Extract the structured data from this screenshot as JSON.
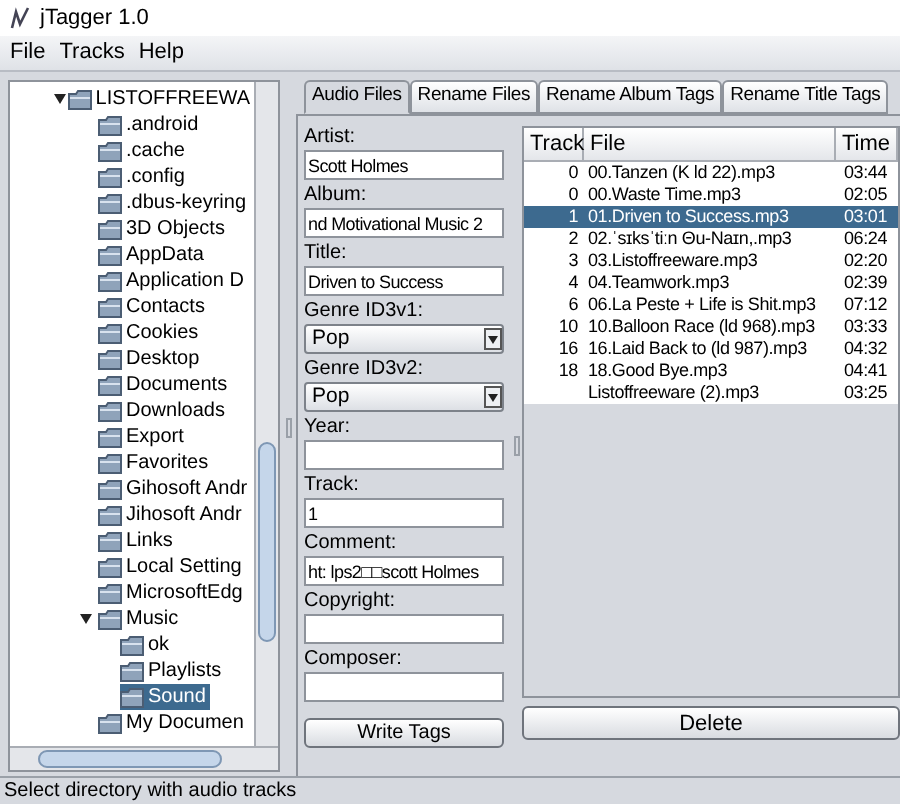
{
  "window": {
    "title": "jTagger 1.0"
  },
  "menu": [
    "File",
    "Tracks",
    "Help"
  ],
  "tree": [
    {
      "label": "LISTOFFREEWA",
      "expanded": true,
      "selected": false,
      "children": [
        {
          "label": ".android",
          "selected": false
        },
        {
          "label": ".cache",
          "selected": false
        },
        {
          "label": ".config",
          "selected": false
        },
        {
          "label": ".dbus-keyring",
          "selected": false
        },
        {
          "label": "3D Objects",
          "selected": false
        },
        {
          "label": "AppData",
          "selected": false
        },
        {
          "label": "Application D",
          "selected": false
        },
        {
          "label": "Contacts",
          "selected": false
        },
        {
          "label": "Cookies",
          "selected": false
        },
        {
          "label": "Desktop",
          "selected": false
        },
        {
          "label": "Documents",
          "selected": false
        },
        {
          "label": "Downloads",
          "selected": false
        },
        {
          "label": "Export",
          "selected": false
        },
        {
          "label": "Favorites",
          "selected": false
        },
        {
          "label": "Gihosoft Andr",
          "selected": false
        },
        {
          "label": "Jihosoft Andr",
          "selected": false
        },
        {
          "label": "Links",
          "selected": false
        },
        {
          "label": "Local Setting",
          "selected": false
        },
        {
          "label": "MicrosoftEdg",
          "selected": false
        },
        {
          "label": "Music",
          "expanded": true,
          "selected": false,
          "children": [
            {
              "label": "ok",
              "selected": false
            },
            {
              "label": "Playlists",
              "selected": false
            },
            {
              "label": "Sound",
              "selected": true
            }
          ]
        },
        {
          "label": "My Documen",
          "selected": false
        }
      ]
    }
  ],
  "tabs": [
    {
      "label": "Audio Files",
      "selected": true
    },
    {
      "label": "Rename Files",
      "selected": false
    },
    {
      "label": "Rename Album Tags",
      "selected": false
    },
    {
      "label": "Rename Title Tags",
      "selected": false
    }
  ],
  "form": [
    {
      "label": "Artist:",
      "kind": "text",
      "value": "Scott Holmes"
    },
    {
      "label": "Album:",
      "kind": "text",
      "value": "nd Motivational Music 2"
    },
    {
      "label": "Title:",
      "kind": "text",
      "value": "Driven to Success"
    },
    {
      "label": "Genre ID3v1:",
      "kind": "select",
      "value": "Pop"
    },
    {
      "label": "Genre ID3v2:",
      "kind": "select",
      "value": "Pop"
    },
    {
      "label": "Year:",
      "kind": "text"
    },
    {
      "label": "Track:",
      "kind": "text",
      "value": "1"
    },
    {
      "label": "Comment:",
      "kind": "text",
      "value": "ht: lps2□□scott Holmes"
    },
    {
      "label": "Copyright:",
      "kind": "text"
    },
    {
      "label": "Composer:",
      "kind": "text"
    }
  ],
  "write_button": "Write Tags",
  "table": {
    "columns": [
      "Track",
      "File",
      "Time"
    ],
    "rows": [
      {
        "cells": [
          "0",
          "00.Tanzen (K ld 22).mp3",
          "03:44"
        ],
        "selected": false
      },
      {
        "cells": [
          "0",
          "00.Waste Time.mp3",
          "02:05"
        ],
        "selected": false
      },
      {
        "cells": [
          "1",
          "01.Driven to Success.mp3",
          "03:01"
        ],
        "selected": true
      },
      {
        "cells": [
          "2",
          "02.ˈsɪksˈtiːn Θu-Naɪn,.mp3",
          "06:24"
        ],
        "selected": false
      },
      {
        "cells": [
          "3",
          "03.Listoffreeware.mp3",
          "02:20"
        ],
        "selected": false
      },
      {
        "cells": [
          "4",
          "04.Teamwork.mp3",
          "02:39"
        ],
        "selected": false
      },
      {
        "cells": [
          "6",
          "06.La Peste + Life is Shit.mp3",
          "07:12"
        ],
        "selected": false
      },
      {
        "cells": [
          "10",
          "10.Balloon Race (ld 968).mp3",
          "03:33"
        ],
        "selected": false
      },
      {
        "cells": [
          "16",
          "16.Laid Back to (ld 987).mp3",
          "04:32"
        ],
        "selected": false
      },
      {
        "cells": [
          "18",
          "18.Good Bye.mp3",
          "04:41"
        ],
        "selected": false
      },
      {
        "cells": [
          "",
          "Listoffreeware (2).mp3",
          "03:25"
        ],
        "selected": false
      }
    ]
  },
  "delete_button": "Delete",
  "status_bar": "Select directory with audio tracks"
}
